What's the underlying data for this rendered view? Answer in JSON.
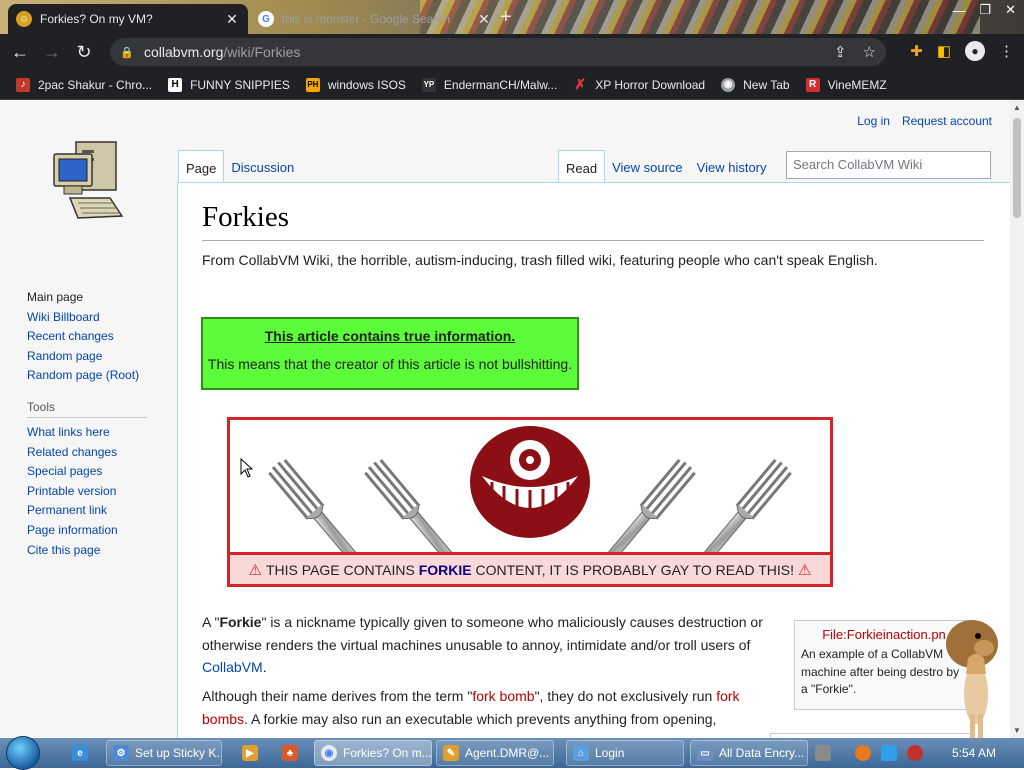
{
  "browser": {
    "tabs": [
      {
        "title": "Forkies? On my VM?",
        "active": true
      },
      {
        "title": "this is monster - Google Search",
        "active": false
      }
    ],
    "new_tab": "+",
    "url_host": "collabvm.org",
    "url_path": "/wiki/Forkies",
    "bookmarks": [
      {
        "label": "2pac Shakur - Chro...",
        "icon": "2pac-icon",
        "color": "#c0392b"
      },
      {
        "label": "FUNNY SNIPPIES",
        "icon": "H",
        "color": "#ffffff"
      },
      {
        "label": "windows ISOS",
        "icon": "PH",
        "color": "#f7a300"
      },
      {
        "label": "EndermanCH/Malw...",
        "icon": "YP",
        "color": "#333333"
      },
      {
        "label": "XP Horror Download",
        "icon": "X",
        "color": "#e53935"
      },
      {
        "label": "New Tab",
        "icon": "globe-icon",
        "color": "#9aa0a6"
      },
      {
        "label": "VineMEMZ",
        "icon": "R",
        "color": "#d32f2f"
      }
    ]
  },
  "wiki": {
    "personal": {
      "login": "Log in",
      "request": "Request account"
    },
    "tabs_left": [
      "Page",
      "Discussion"
    ],
    "tabs_right": [
      "Read",
      "View source",
      "View history"
    ],
    "search_placeholder": "Search CollabVM Wiki",
    "sidebar": {
      "nav": [
        "Main page",
        "Wiki Billboard",
        "Recent changes",
        "Random page",
        "Random page (Root)"
      ],
      "tools_heading": "Tools",
      "tools": [
        "What links here",
        "Related changes",
        "Special pages",
        "Printable version",
        "Permanent link",
        "Page information",
        "Cite this page"
      ]
    },
    "title": "Forkies",
    "tagline": "From CollabVM Wiki, the horrible, autism-inducing, trash filled wiki, featuring people who can't speak English.",
    "notice": {
      "heading": "This article contains true information.",
      "body": "This means that the creator of this article is not bullshitting."
    },
    "warning": {
      "pre": "THIS PAGE CONTAINS ",
      "bold": "FORKIE",
      "post": " CONTENT, IT IS PROBABLY GAY TO READ THIS!"
    },
    "para1": {
      "t1": "A \"",
      "b1": "Forkie",
      "t2": "\" is a nickname typically given to someone who maliciously causes destruction or otherwise renders the virtual machines unusable to annoy, intimidate and/or troll users of ",
      "link1": "CollabVM",
      "t3": "."
    },
    "para2": {
      "t1": "Although their name derives from the term \"",
      "link1": "fork bomb",
      "t2": "\", they do not exclusively run ",
      "link2": "fork bombs",
      "t3": ". A forkie may also run an executable which prevents anything from opening,"
    },
    "thumb": {
      "file": "File:Forkieinaction.pn",
      "caption": "An example of a CollabVM machine after being destro by a \"Forkie\"."
    }
  },
  "taskbar": {
    "items": [
      {
        "label": "Set up Sticky K...",
        "icon": "settings-icon",
        "color": "#4c8ad6"
      },
      {
        "label": "Forkies? On m...",
        "icon": "chrome-icon",
        "color": "#e8eaed"
      },
      {
        "label": "Agent.DMR@...",
        "icon": "paint-icon",
        "color": "#e0a030"
      },
      {
        "label": "Login",
        "icon": "network-icon",
        "color": "#5aa0e0"
      },
      {
        "label": "All Data Encry...",
        "icon": "window-icon",
        "color": "#6c8ebf"
      }
    ],
    "clock": "5:54 AM"
  }
}
